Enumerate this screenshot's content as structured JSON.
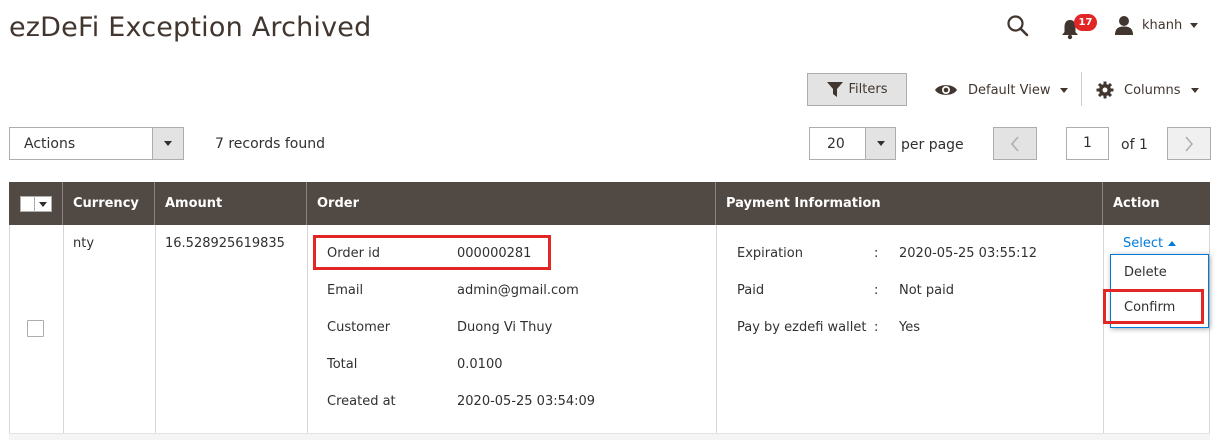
{
  "header": {
    "title": "ezDeFi Exception Archived",
    "notifications_count": "17",
    "user_name": "khanh"
  },
  "toolbar": {
    "filters_label": "Filters",
    "view_label": "Default View",
    "columns_label": "Columns"
  },
  "grid_controls": {
    "actions_label": "Actions",
    "records_found": "7 records found",
    "per_page_value": "20",
    "per_page_label": "per page",
    "current_page": "1",
    "page_of": "of 1"
  },
  "table": {
    "columns": [
      "Currency",
      "Amount",
      "Order",
      "Payment Information",
      "Action"
    ],
    "row": {
      "currency": "nty",
      "amount": "16.528925619835",
      "order": {
        "order_id_label": "Order id",
        "order_id": "000000281",
        "email_label": "Email",
        "email": "admin@gmail.com",
        "customer_label": "Customer",
        "customer": "Duong Vi Thuy",
        "total_label": "Total",
        "total": "0.0100",
        "created_label": "Created at",
        "created": "2020-05-25 03:54:09"
      },
      "payment": {
        "expiration_label": "Expiration",
        "expiration": "2020-05-25 03:55:12",
        "paid_label": "Paid",
        "paid": "Not paid",
        "wallet_label": "Pay by ezdefi wallet",
        "wallet": "Yes",
        "separator": ":"
      },
      "action": {
        "select_label": "Select",
        "menu": [
          "Delete",
          "Confirm"
        ]
      }
    }
  },
  "colors": {
    "header_bg": "#514943",
    "link": "#007bdb",
    "highlight": "#e22626"
  }
}
